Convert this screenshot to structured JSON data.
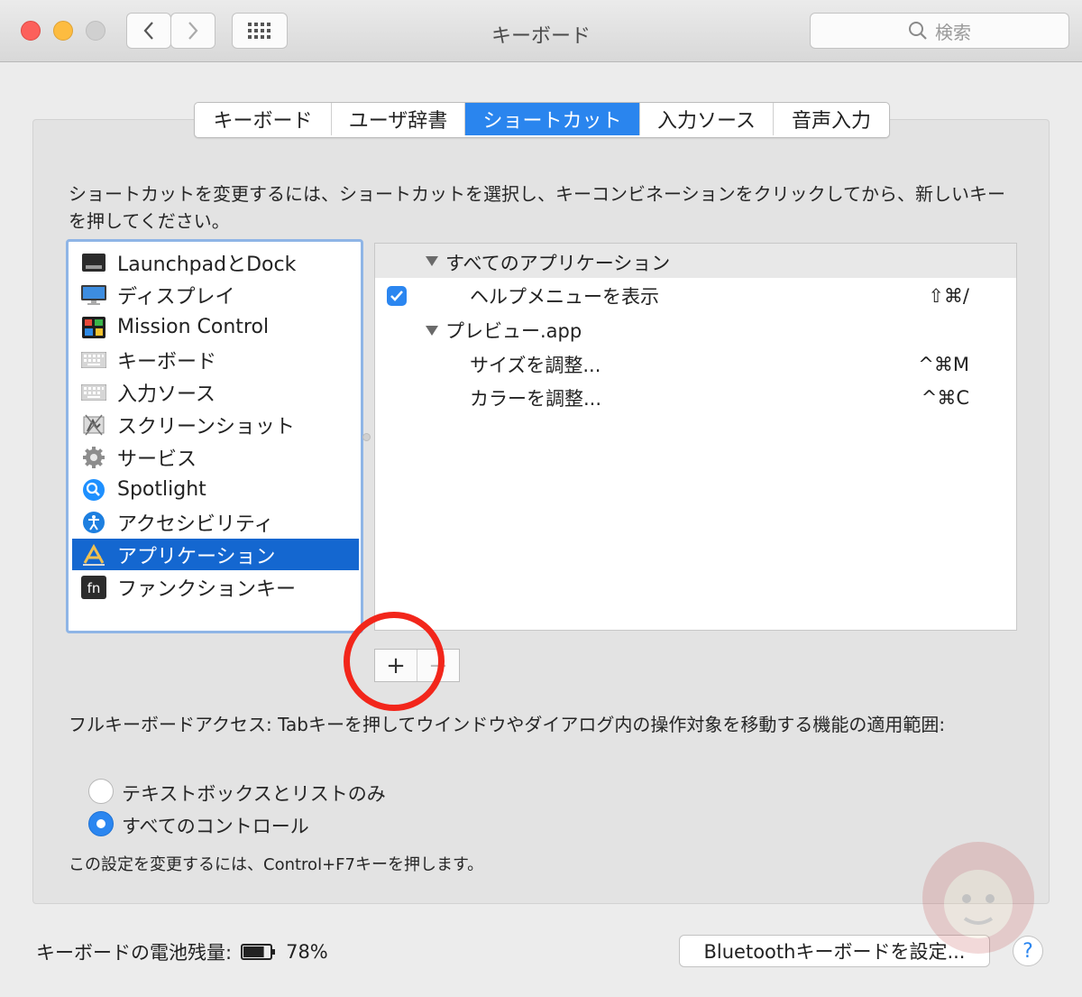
{
  "window": {
    "title": "キーボード"
  },
  "toolbar": {
    "search_placeholder": "検索"
  },
  "tabs": [
    {
      "label": "キーボード",
      "active": false
    },
    {
      "label": "ユーザ辞書",
      "active": false
    },
    {
      "label": "ショートカット",
      "active": true
    },
    {
      "label": "入力ソース",
      "active": false
    },
    {
      "label": "音声入力",
      "active": false
    }
  ],
  "instructions": "ショートカットを変更するには、ショートカットを選択し、キーコンビネーションをクリックしてから、新しいキーを押してください。",
  "categories": [
    {
      "label": "LaunchpadとDock",
      "icon": "dock-icon"
    },
    {
      "label": "ディスプレイ",
      "icon": "display-icon"
    },
    {
      "label": "Mission Control",
      "icon": "mission-control-icon"
    },
    {
      "label": "キーボード",
      "icon": "keyboard-icon"
    },
    {
      "label": "入力ソース",
      "icon": "keyboard-icon"
    },
    {
      "label": "スクリーンショット",
      "icon": "screenshot-icon"
    },
    {
      "label": "サービス",
      "icon": "gear-icon"
    },
    {
      "label": "Spotlight",
      "icon": "spotlight-icon"
    },
    {
      "label": "アクセシビリティ",
      "icon": "accessibility-icon"
    },
    {
      "label": "アプリケーション",
      "icon": "app-store-icon",
      "selected": true
    },
    {
      "label": "ファンクションキー",
      "icon": "fn-icon"
    }
  ],
  "shortcuts": {
    "group_all": "すべてのアプリケーション",
    "help_menu": {
      "label": "ヘルプメニューを表示",
      "keys": "⇧⌘/",
      "checked": true
    },
    "group_preview": "プレビュー.app",
    "adjust_size": {
      "label": "サイズを調整...",
      "keys": "^⌘M"
    },
    "adjust_color": {
      "label": "カラーを調整...",
      "keys": "^⌘C"
    }
  },
  "buttons": {
    "add": "+",
    "remove": "−"
  },
  "full_keyboard_access": {
    "text": "フルキーボードアクセス: Tabキーを押してウインドウやダイアログ内の操作対象を移動する機能の適用範囲:",
    "option_text_lists": "テキストボックスとリストのみ",
    "option_all": "すべてのコントロール",
    "selected": "option_all",
    "note": "この設定を変更するには、Control+F7キーを押します。"
  },
  "footer": {
    "battery_label": "キーボードの電池残量:",
    "battery_value": "78%",
    "battery_level": 0.78,
    "bluetooth_button": "Bluetoothキーボードを設定...",
    "help": "?"
  },
  "colors": {
    "accent": "#2a85ee",
    "selection": "#1467d0",
    "annotation_circle": "#f2261b"
  }
}
